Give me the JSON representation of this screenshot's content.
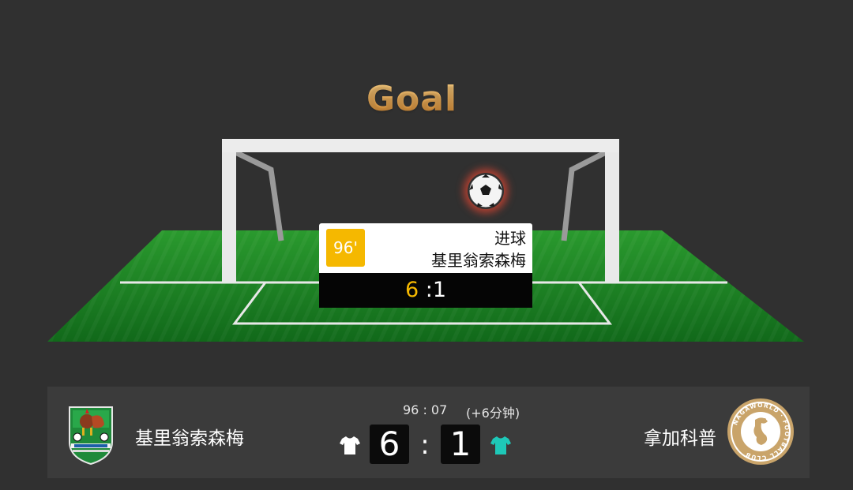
{
  "header": {
    "title": "Goal"
  },
  "event": {
    "minute": "96'",
    "type": "进球",
    "player": "基里翁索森梅",
    "score_home": "6",
    "score_separator": " :",
    "score_away": "1"
  },
  "scoreboard": {
    "match_time": "96 : 07",
    "added_time": "(+6分钟)",
    "home_team": "基里翁索森梅",
    "away_team": "拿加科普",
    "home_score": "6",
    "away_score": "1",
    "colon": ":"
  },
  "logos": {
    "away_ring_text": "NAGAWORLD · FOOTBALL CLUB"
  },
  "colors": {
    "background": "#303030",
    "pitch_green": "#1f8f23",
    "minute_badge": "#f5b800",
    "home_score_highlight": "#f5b800",
    "title_gold": "#e8a544",
    "away_kit": "#1ec8b8",
    "home_kit": "#ffffff"
  },
  "icons": {
    "ball": "soccer-ball-icon",
    "home_kit": "white-shirt-icon",
    "away_kit": "teal-shirt-icon"
  }
}
